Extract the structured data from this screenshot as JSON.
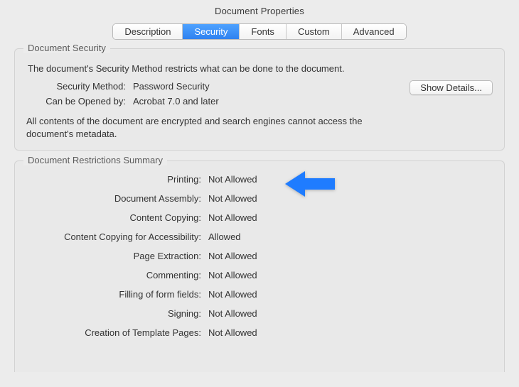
{
  "window": {
    "title": "Document Properties"
  },
  "tabs": {
    "items": [
      {
        "label": "Description",
        "active": false
      },
      {
        "label": "Security",
        "active": true
      },
      {
        "label": "Fonts",
        "active": false
      },
      {
        "label": "Custom",
        "active": false
      },
      {
        "label": "Advanced",
        "active": false
      }
    ]
  },
  "security": {
    "legend": "Document Security",
    "intro": "The document's Security Method restricts what can be done to the document.",
    "method_label": "Security Method:",
    "method_value": "Password Security",
    "opened_label": "Can be Opened by:",
    "opened_value": "Acrobat 7.0 and later",
    "note": "All contents of the document are encrypted and search engines cannot access the document's metadata.",
    "show_details_label": "Show Details..."
  },
  "restrictions": {
    "legend": "Document Restrictions Summary",
    "rows": [
      {
        "label": "Printing:",
        "value": "Not Allowed"
      },
      {
        "label": "Document Assembly:",
        "value": "Not Allowed"
      },
      {
        "label": "Content Copying:",
        "value": "Not Allowed"
      },
      {
        "label": "Content Copying for Accessibility:",
        "value": "Allowed"
      },
      {
        "label": "Page Extraction:",
        "value": "Not Allowed"
      },
      {
        "label": "Commenting:",
        "value": "Not Allowed"
      },
      {
        "label": "Filling of form fields:",
        "value": "Not Allowed"
      },
      {
        "label": "Signing:",
        "value": "Not Allowed"
      },
      {
        "label": "Creation of Template Pages:",
        "value": "Not Allowed"
      }
    ]
  },
  "annotation": {
    "arrow_color": "#1f7cff"
  }
}
